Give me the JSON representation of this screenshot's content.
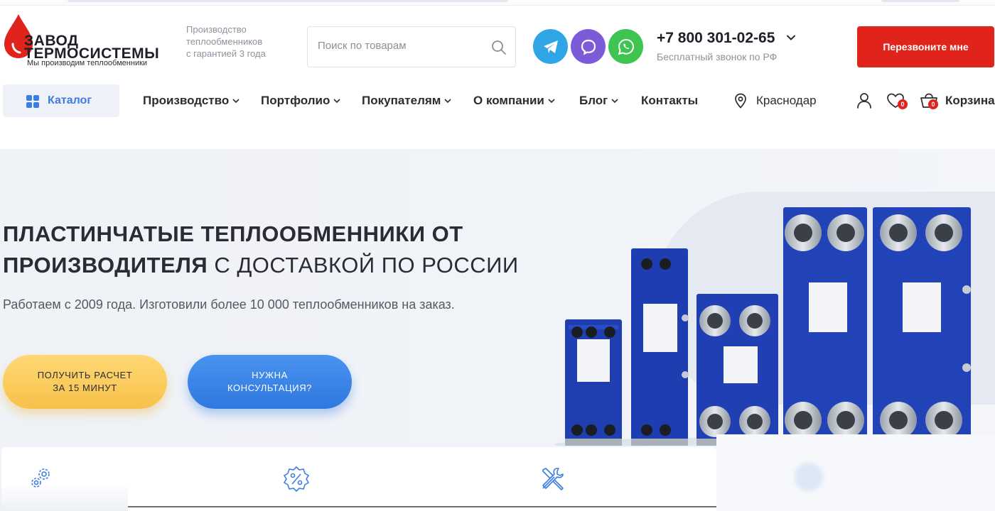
{
  "header": {
    "logo": {
      "line1": "ЗАВОД",
      "line2": "ТЕРМОСИСТЕМЫ",
      "slogan": "Мы производим теплообменники"
    },
    "tagline": [
      "Производство",
      "теплообменников",
      "с гарантией 3 года"
    ],
    "search": {
      "placeholder": "Поиск по товарам"
    },
    "messengers": [
      "telegram-icon",
      "viber-icon",
      "whatsapp-icon"
    ],
    "phone": "+7 800 301-02-65",
    "phone_note": "Бесплатный звонок по РФ",
    "callback_label": "Перезвоните мне"
  },
  "nav": {
    "catalog_label": "Каталог",
    "items": [
      {
        "label": "Производство",
        "has_dropdown": true
      },
      {
        "label": "Портфолио",
        "has_dropdown": true
      },
      {
        "label": "Покупателям",
        "has_dropdown": true
      },
      {
        "label": "О компании",
        "has_dropdown": true
      },
      {
        "label": "Блог",
        "has_dropdown": true
      },
      {
        "label": "Контакты",
        "has_dropdown": false
      }
    ],
    "city": "Краснодар",
    "favorites_count": "0",
    "cart_count": "0",
    "cart_label": "Корзина"
  },
  "hero": {
    "title_bold_1": "ПЛАСТИНЧАТЫЕ ТЕПЛООБМЕННИКИ ОТ",
    "title_bold_2": "ПРОИЗВОДИТЕЛЯ",
    "title_light": " С ДОСТАВКОЙ ПО РОССИИ",
    "subtitle": "Работаем с 2009 года. Изготовили более 10 000 теплообменников на заказ.",
    "btn_calc": [
      "ПОЛУЧИТЬ РАСЧЕТ",
      "ЗА 15 МИНУТ"
    ],
    "btn_consult": [
      "НУЖНА",
      "КОНСУЛЬТАЦИЯ?"
    ]
  },
  "features": {
    "icons": [
      "gears-icon",
      "discount-badge-icon",
      "tools-icon"
    ]
  },
  "colors": {
    "accent_blue": "#3b7de1",
    "accent_red": "#e0231b",
    "accent_yellow": "#f7c14a",
    "text_dark": "#2b2b33",
    "text_muted": "#8e929c"
  }
}
